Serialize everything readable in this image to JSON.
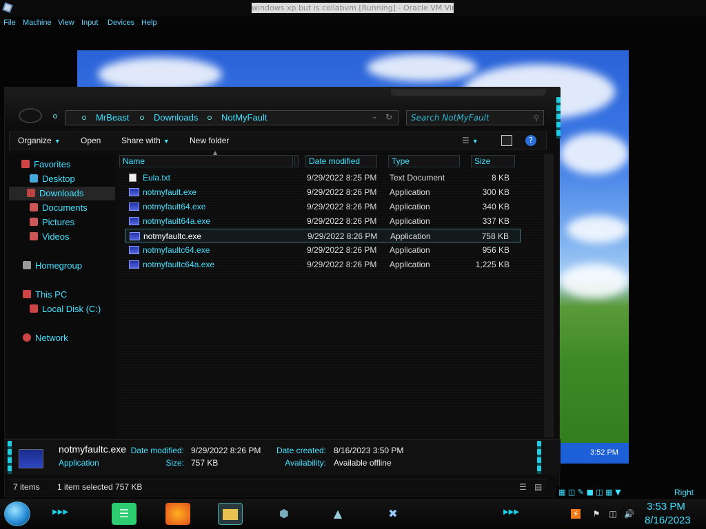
{
  "vbox": {
    "window_title": "windows xp but is collabvm [Running] - Oracle VM VirtualBox",
    "menu": [
      "File",
      "Machine",
      "View",
      "Input",
      "Devices",
      "Help"
    ]
  },
  "guest_tray": {
    "time": "3:52 PM"
  },
  "explorer": {
    "breadcrumb": [
      "MrBeast",
      "Downloads",
      "NotMyFault"
    ],
    "search_placeholder": "Search NotMyFault",
    "toolbar": {
      "organize": "Organize",
      "open": "Open",
      "share_with": "Share with",
      "new_folder": "New folder"
    },
    "nav": {
      "favorites": "Favorites",
      "desktop": "Desktop",
      "downloads": "Downloads",
      "documents": "Documents",
      "pictures": "Pictures",
      "videos": "Videos",
      "homegroup": "Homegroup",
      "this_pc": "This PC",
      "local_disk": "Local Disk (C:)",
      "network": "Network"
    },
    "columns": {
      "name": "Name",
      "date": "Date modified",
      "type": "Type",
      "size": "Size"
    },
    "files": [
      {
        "name": "Eula.txt",
        "date": "9/29/2022 8:25 PM",
        "type": "Text Document",
        "size": "8 KB"
      },
      {
        "name": "notmyfault.exe",
        "date": "9/29/2022 8:26 PM",
        "type": "Application",
        "size": "300 KB"
      },
      {
        "name": "notmyfault64.exe",
        "date": "9/29/2022 8:26 PM",
        "type": "Application",
        "size": "340 KB"
      },
      {
        "name": "notmyfault64a.exe",
        "date": "9/29/2022 8:26 PM",
        "type": "Application",
        "size": "337 KB"
      },
      {
        "name": "notmyfaultc.exe",
        "date": "9/29/2022 8:26 PM",
        "type": "Application",
        "size": "758 KB"
      },
      {
        "name": "notmyfaultc64.exe",
        "date": "9/29/2022 8:26 PM",
        "type": "Application",
        "size": "956 KB"
      },
      {
        "name": "notmyfaultc64a.exe",
        "date": "9/29/2022 8:26 PM",
        "type": "Application",
        "size": "1,225 KB"
      }
    ],
    "selected_index": 4,
    "details": {
      "name": "notmyfaultc.exe",
      "type": "Application",
      "date_modified_label": "Date modified:",
      "date_modified": "9/29/2022 8:26 PM",
      "size_label": "Size:",
      "size": "757 KB",
      "date_created_label": "Date created:",
      "date_created": "8/16/2023 3:50 PM",
      "availability_label": "Availability:",
      "availability": "Available offline"
    },
    "status": {
      "items": "7 items",
      "selected": "1 item selected  757 KB"
    }
  },
  "host_taskbar": {
    "right_ctrl": "Right Ctrl",
    "time": "3:53 PM",
    "date": "8/16/2023"
  },
  "colors": {
    "accent": "#3fe0ff",
    "background": "#0d0d0d",
    "xp_sky": "#2a63d8",
    "xp_grass": "#3f8a28"
  }
}
